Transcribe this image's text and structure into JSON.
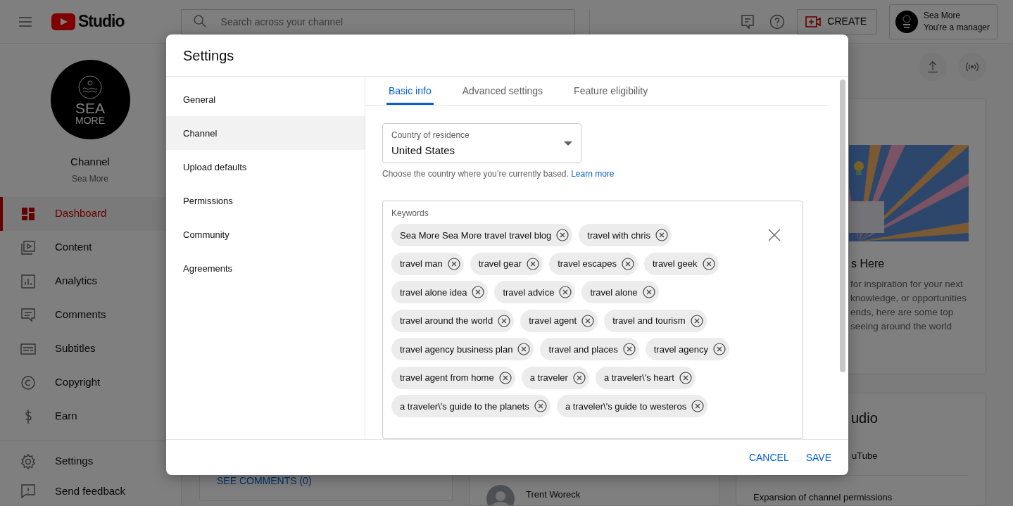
{
  "topbar": {
    "logo_text": "Studio",
    "search": {
      "placeholder": "Search across your channel"
    },
    "create_button": "CREATE",
    "account": {
      "name": "Sea More",
      "role": "You're a manager"
    }
  },
  "sidebar": {
    "avatar_lines": [
      "SEA",
      "MORE"
    ],
    "channel_label": "Channel",
    "channel_name": "Sea More",
    "items": [
      {
        "label": "Dashboard",
        "selected": true
      },
      {
        "label": "Content",
        "selected": false
      },
      {
        "label": "Analytics",
        "selected": false
      },
      {
        "label": "Comments",
        "selected": false
      },
      {
        "label": "Subtitles",
        "selected": false
      },
      {
        "label": "Copyright",
        "selected": false
      },
      {
        "label": "Earn",
        "selected": false
      }
    ],
    "footer_items": [
      {
        "label": "Settings"
      },
      {
        "label": "Send feedback"
      }
    ]
  },
  "dashboard": {
    "comments_link": "SEE COMMENTS (0)",
    "comment_author": "Trent Woreck",
    "news_card": {
      "title": "s Here",
      "lines": [
        "for inspiration for your next",
        "knowledge, or opportunities",
        "ends, here are some top",
        "seeing around the world"
      ]
    },
    "studio_card": {
      "title": "udio",
      "item_1": "uTube",
      "item_2": "Expansion of channel permissions"
    }
  },
  "dialog": {
    "title": "Settings",
    "nav": [
      {
        "label": "General",
        "selected": false
      },
      {
        "label": "Channel",
        "selected": true
      },
      {
        "label": "Upload defaults",
        "selected": false
      },
      {
        "label": "Permissions",
        "selected": false
      },
      {
        "label": "Community",
        "selected": false
      },
      {
        "label": "Agreements",
        "selected": false
      }
    ],
    "tabs": [
      {
        "label": "Basic info",
        "selected": true
      },
      {
        "label": "Advanced settings",
        "selected": false
      },
      {
        "label": "Feature eligibility",
        "selected": false
      }
    ],
    "country": {
      "label": "Country of residence",
      "value": "United States",
      "helper": "Choose the country where you’re currently based.",
      "link": "Learn more"
    },
    "keywords": {
      "label": "Keywords",
      "chips": [
        "Sea More Sea More travel travel blog",
        "travel with chris",
        "travel man",
        "travel gear",
        "travel escapes",
        "travel geek",
        "travel alone idea",
        "travel advice",
        "travel alone",
        "travel around the world",
        "travel agent",
        "travel and tourism",
        "travel agency business plan",
        "travel and places",
        "travel agency",
        "travel agent from home",
        "a traveler",
        "a traveler\\'s heart",
        "a traveler\\'s guide to the planets",
        "a traveler\\'s guide to westeros"
      ]
    },
    "buttons": [
      "CANCEL",
      "SAVE"
    ]
  }
}
